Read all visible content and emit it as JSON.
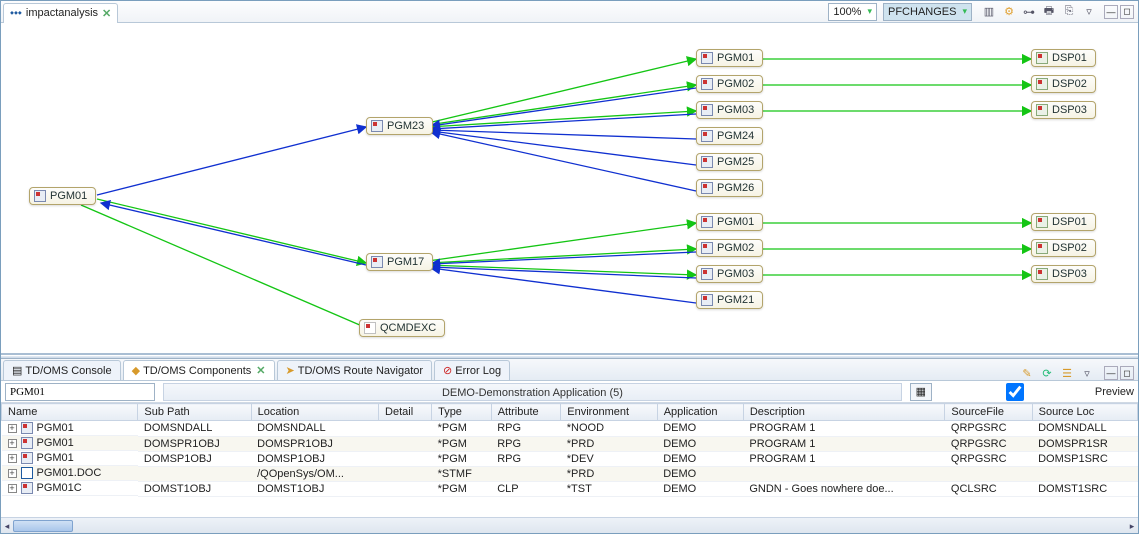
{
  "top": {
    "title": "impactanalysis",
    "zoom": "100%",
    "filter": "PFCHANGES"
  },
  "nodes": {
    "root": {
      "label": "PGM01"
    },
    "l2a": {
      "label": "PGM23"
    },
    "l2b": {
      "label": "PGM17"
    },
    "l2c": {
      "label": "QCMDEXC"
    },
    "a1": {
      "label": "PGM01"
    },
    "a2": {
      "label": "PGM02"
    },
    "a3": {
      "label": "PGM03"
    },
    "a4": {
      "label": "PGM24"
    },
    "a5": {
      "label": "PGM25"
    },
    "a6": {
      "label": "PGM26"
    },
    "b1": {
      "label": "PGM01"
    },
    "b2": {
      "label": "PGM02"
    },
    "b3": {
      "label": "PGM03"
    },
    "b4": {
      "label": "PGM21"
    },
    "d1": {
      "label": "DSP01"
    },
    "d2": {
      "label": "DSP02"
    },
    "d3": {
      "label": "DSP03"
    },
    "e1": {
      "label": "DSP01"
    },
    "e2": {
      "label": "DSP02"
    },
    "e3": {
      "label": "DSP03"
    }
  },
  "bottom": {
    "tabs": [
      {
        "label": "TD/OMS Console"
      },
      {
        "label": "TD/OMS Components"
      },
      {
        "label": "TD/OMS Route Navigator"
      },
      {
        "label": "Error Log"
      }
    ],
    "filter_value": "PGM01",
    "center_label": "DEMO-Demonstration Application (5)",
    "preview_label": "Preview",
    "columns": [
      "Name",
      "Sub Path",
      "Location",
      "Detail",
      "Type",
      "Attribute",
      "Environment",
      "Application",
      "Description",
      "SourceFile",
      "Source Loc"
    ],
    "rows": [
      {
        "name": "PGM01",
        "sub": "DOMSNDALL",
        "loc": "DOMSNDALL",
        "detail": "",
        "type": "*PGM",
        "attr": "RPG",
        "env": "*NOOD",
        "app": "DEMO",
        "desc": "PROGRAM 1",
        "sf": "QRPGSRC",
        "sl": "DOMSNDALL",
        "icon": "pgm"
      },
      {
        "name": "PGM01",
        "sub": "DOMSPR1OBJ",
        "loc": "DOMSPR1OBJ",
        "detail": "",
        "type": "*PGM",
        "attr": "RPG",
        "env": "*PRD",
        "app": "DEMO",
        "desc": "PROGRAM 1",
        "sf": "QRPGSRC",
        "sl": "DOMSPR1SR",
        "icon": "pgm"
      },
      {
        "name": "PGM01",
        "sub": "DOMSP1OBJ",
        "loc": "DOMSP1OBJ",
        "detail": "",
        "type": "*PGM",
        "attr": "RPG",
        "env": "*DEV",
        "app": "DEMO",
        "desc": "PROGRAM 1",
        "sf": "QRPGSRC",
        "sl": "DOMSP1SRC",
        "icon": "pgm"
      },
      {
        "name": "PGM01.DOC",
        "sub": "",
        "loc": "/QOpenSys/OM...",
        "detail": "",
        "type": "*STMF",
        "attr": "",
        "env": "*PRD",
        "app": "DEMO",
        "desc": "",
        "sf": "",
        "sl": "",
        "icon": "doc"
      },
      {
        "name": "PGM01C",
        "sub": "DOMST1OBJ",
        "loc": "DOMST1OBJ",
        "detail": "",
        "type": "*PGM",
        "attr": "CLP",
        "env": "*TST",
        "app": "DEMO",
        "desc": "GNDN - Goes nowhere doe...",
        "sf": "QCLSRC",
        "sl": "DOMST1SRC",
        "icon": "pgm"
      }
    ]
  }
}
